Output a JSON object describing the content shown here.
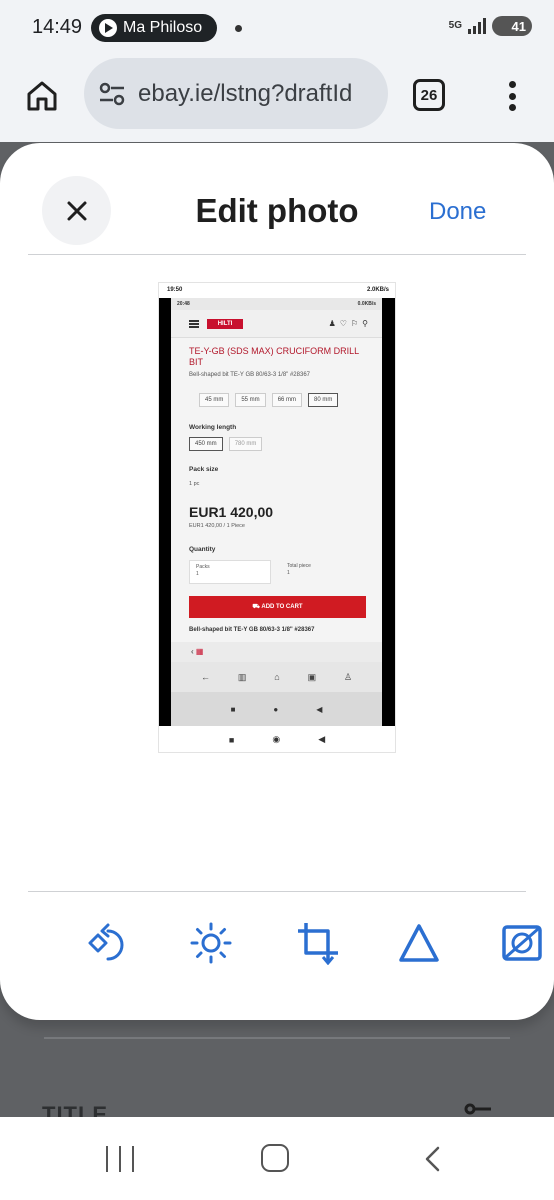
{
  "status_bar": {
    "time": "14:49",
    "media_title": "Ma Philoso",
    "network": "5G",
    "battery": "41"
  },
  "browser": {
    "url": "ebay.ie/lstng?draftId",
    "tab_count": "26"
  },
  "dialog": {
    "title": "Edit photo",
    "done_label": "Done",
    "close_icon": "close-icon"
  },
  "photo": {
    "outer_time": "19:50",
    "outer_status": "2.0KB/s",
    "inner_time": "20:48",
    "inner_status": "0.0KB/s",
    "brand": "HILTI",
    "product_title": "TE-Y-GB (SDS MAX) CRUCIFORM DRILL BIT",
    "product_subtitle": "Bell-shaped bit TE-Y GB 80/63-3 1/8\" #28367",
    "sizes": [
      "45 mm",
      "55 mm",
      "66 mm",
      "80 mm"
    ],
    "selected_size": "80 mm",
    "working_length_label": "Working length",
    "working_lengths": [
      "450 mm",
      "780 mm"
    ],
    "pack_size_label": "Pack size",
    "pack_size_value": "1 pc",
    "price": "EUR1 420,00",
    "price_sub": "EUR1 420,00 / 1 Piece",
    "quantity_label": "Quantity",
    "packs_label": "Packs",
    "packs_value": "1",
    "total_label": "Total piece",
    "total_value": "1",
    "cart_button": "ADD TO CART",
    "related": "Bell-shaped bit TE-Y GB 80/63-3 1/8\" #28367"
  },
  "tools": [
    {
      "name": "rotate-icon"
    },
    {
      "name": "brightness-icon"
    },
    {
      "name": "crop-icon"
    },
    {
      "name": "triangle-icon"
    },
    {
      "name": "background-removal-icon"
    }
  ],
  "background_page": {
    "section_title": "TITLE"
  },
  "colors": {
    "accent": "#2b6fd1",
    "brand_red": "#d01b22"
  }
}
